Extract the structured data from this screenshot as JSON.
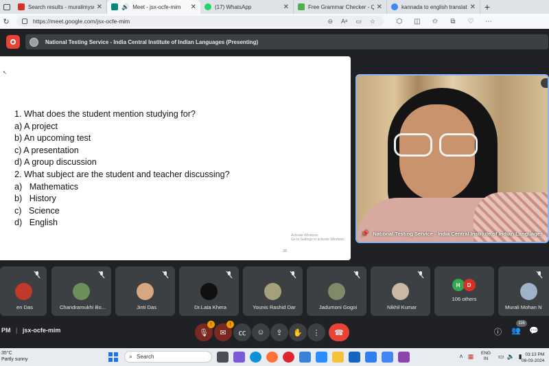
{
  "browser": {
    "tabs": [
      {
        "title": "Search results - muralimysuru@",
        "color": "#d93025"
      },
      {
        "title": "Meet - jsx-ocfe-mim",
        "color": "#00897b",
        "active": true
      },
      {
        "title": "(17) WhatsApp",
        "color": "#25d366"
      },
      {
        "title": "Free Grammar Checker - Quillb",
        "color": "#4caf50"
      },
      {
        "title": "kannada to english translation",
        "color": "#4285f4"
      }
    ],
    "url": "https://meet.google.com/jsx-ocfe-mim"
  },
  "meet": {
    "presenting_banner": "National Testing Service - India Central Institute of Indian Languages (Presenting)",
    "speaker_name": "National Testing Service - India Central Institute of Indian Languages",
    "meeting_time": "PM",
    "meeting_code": "jsx-ocfe-mim",
    "participant_count_badge": "116",
    "mic_badge": "!",
    "cam_badge": "!"
  },
  "slide": {
    "lines": [
      "1. What does the student mention studying for?",
      "a) A project",
      "b) An upcoming test",
      "c) A presentation",
      "d) A group discussion",
      "2. What subject are the student and teacher discussing?",
      "a)   Mathematics",
      "b)   History",
      "c)   Science",
      "d)   English"
    ],
    "activate_windows": "Activate Windows",
    "activate_hint": "Go to Settings to activate Windows.",
    "page_number": "28"
  },
  "participants": [
    {
      "name": "en Das",
      "avatar_color": "#c0392b"
    },
    {
      "name": "Chandramukhi Bo...",
      "avatar_color": "#6d8f5a"
    },
    {
      "name": "Jinti Das",
      "avatar_color": "#d8a77f"
    },
    {
      "name": "Dr.Lata Khera",
      "avatar_color": "#111111"
    },
    {
      "name": "Younis Rashid Dar",
      "avatar_color": "#a4a07a"
    },
    {
      "name": "Jadumoni Gogoi",
      "avatar_color": "#7e8a6a"
    },
    {
      "name": "Nikhil Kumar",
      "avatar_color": "#c9b8a4"
    },
    {
      "name": "Murali Mohan N",
      "avatar_color": "#9fb3c8"
    }
  ],
  "others": {
    "initial_1": "H",
    "initial_2": "D",
    "label": "106 others"
  },
  "taskbar": {
    "temperature": "35°C",
    "weather": "Partly sunny",
    "search_placeholder": "Search",
    "lang_1": "ENG",
    "lang_2": "IN",
    "time": "03:13 PM",
    "date": "08-03-2024"
  }
}
